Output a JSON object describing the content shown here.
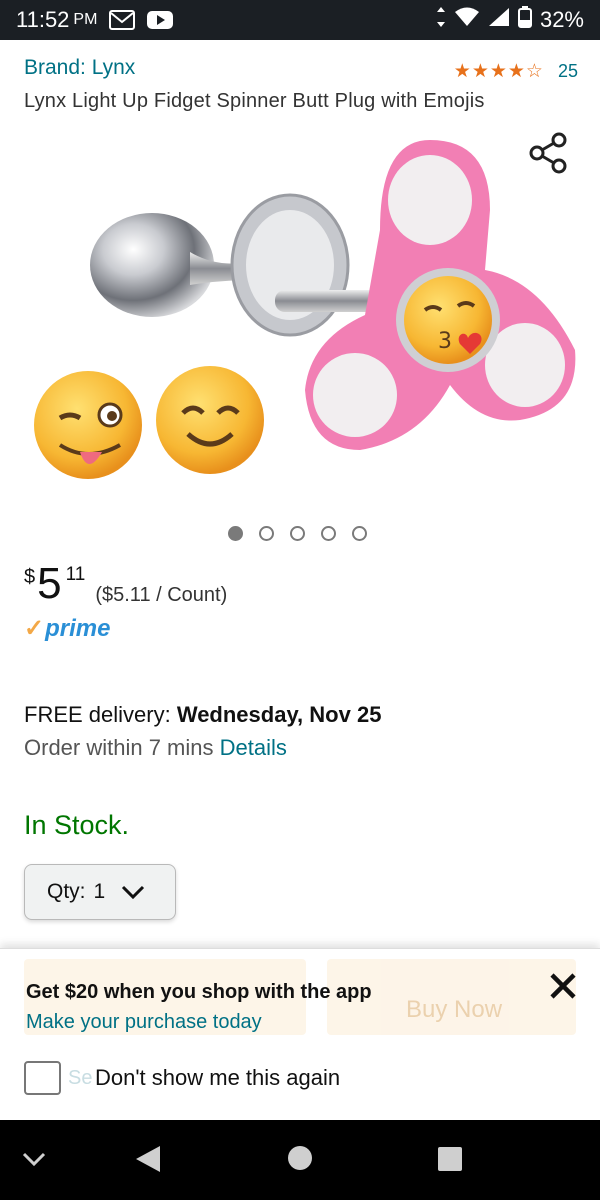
{
  "status_bar": {
    "time": "11:52",
    "ampm": "PM",
    "battery": "32%"
  },
  "product": {
    "brand": "Brand: Lynx",
    "rating_stars": "★★★★☆",
    "rating_count": "25",
    "title": "Lynx Light Up Fidget Spinner Butt Plug with Emojis",
    "image_count": 5,
    "image_index": 1
  },
  "price": {
    "currency": "$",
    "whole": "5",
    "fraction": "11",
    "per_unit": "($5.11 / Count)"
  },
  "prime": {
    "check": "✓",
    "label": "prime"
  },
  "delivery": {
    "prefix": "FREE delivery: ",
    "date": "Wednesday, Nov 25",
    "order_prefix": "Order within 7 mins ",
    "details_link": "Details"
  },
  "stock": "In Stock.",
  "quantity": {
    "label": "Qty:",
    "value": "1"
  },
  "promo_sheet": {
    "headline": "Get $20 when you shop with the app",
    "subline": "Make your purchase today",
    "dont_show": "Don't show me this again",
    "behind_right_button": "Buy Now",
    "behind_left_partial": "Se"
  },
  "colors": {
    "link": "#007185",
    "stock_green": "#007600",
    "star": "#e7711b",
    "prime_blue": "#2a8fd6",
    "prime_check": "#f3a847"
  }
}
